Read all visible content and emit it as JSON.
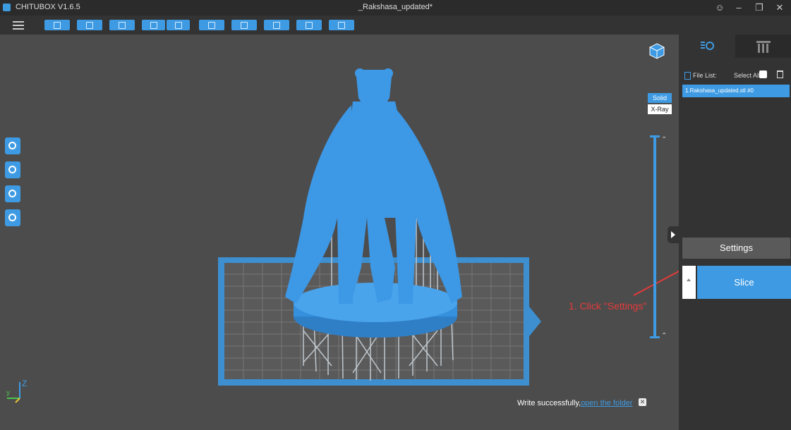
{
  "window": {
    "app_name": "CHITUBOX V1.6.5",
    "document_title": "_Rakshasa_updated*",
    "controls": [
      "user",
      "minimize",
      "restore",
      "close"
    ]
  },
  "toolbar": {
    "buttons": [
      "open-file-icon",
      "save-file-icon",
      "slice-preview-icon",
      "import-icon",
      "export-icon",
      "copy-icon",
      "arrange-icon",
      "support-icon",
      "hollow-icon",
      "dig-hole-icon"
    ]
  },
  "viewport": {
    "view_modes": {
      "solid": "Solid",
      "xray": "X-Ray",
      "selected": "Solid"
    },
    "left_tools": [
      "move-icon",
      "rotate-icon",
      "scale-icon",
      "mirror-icon"
    ],
    "axes": {
      "z": "Z",
      "y": "y"
    },
    "annotation": "1. Click \"Settings\"",
    "toast": {
      "message": "Write successfully,",
      "link": "open the folder"
    }
  },
  "right_panel": {
    "tabs": [
      "file-list-tab",
      "support-tab"
    ],
    "file_list_label": "File List:",
    "select_all_label": "Select All",
    "files": [
      "1.Rakshasa_updated.stl #0"
    ],
    "settings_label": "Settings",
    "slice_label": "Slice"
  },
  "colors": {
    "accent": "#3e9be3",
    "annotation": "#e53a3a",
    "background": "#4c4c4c",
    "panel": "#333333"
  }
}
